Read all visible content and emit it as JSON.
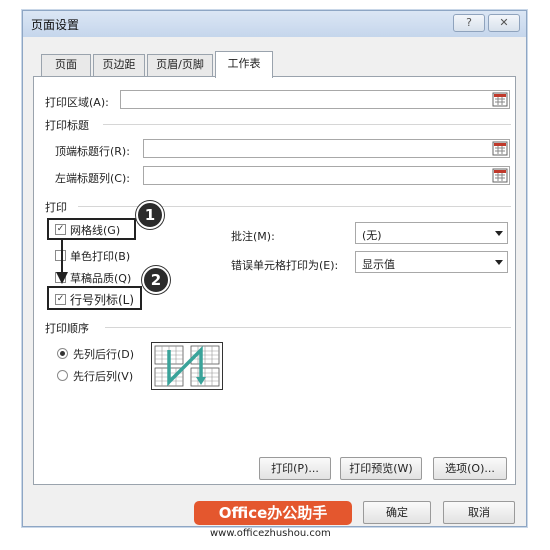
{
  "dialog": {
    "title": "页面设置",
    "help_label": "?",
    "close_label": "✕"
  },
  "tabs": [
    {
      "label": "页面",
      "active": false
    },
    {
      "label": "页边距",
      "active": false
    },
    {
      "label": "页眉/页脚",
      "active": false
    },
    {
      "label": "工作表",
      "active": true
    }
  ],
  "print_area": {
    "label": "打印区域(A):",
    "value": ""
  },
  "print_titles": {
    "heading": "打印标题",
    "top_rows": {
      "label": "顶端标题行(R):",
      "value": ""
    },
    "left_cols": {
      "label": "左端标题列(C):",
      "value": ""
    }
  },
  "print": {
    "heading": "打印",
    "gridlines": {
      "label": "网格线(G)",
      "checked": true
    },
    "black_white": {
      "label": "单色打印(B)",
      "checked": false
    },
    "draft": {
      "label": "草稿品质(Q)",
      "checked": false
    },
    "row_col_headings": {
      "label": "行号列标(L)",
      "checked": true
    },
    "comments": {
      "label": "批注(M):",
      "value": "(无)"
    },
    "cell_errors": {
      "label": "错误单元格打印为(E):",
      "value": "显示值"
    }
  },
  "page_order": {
    "heading": "打印顺序",
    "down_then_over": {
      "label": "先列后行(D)",
      "selected": true
    },
    "over_then_down": {
      "label": "先行后列(V)",
      "selected": false
    }
  },
  "buttons": {
    "print": "打印(P)...",
    "preview": "打印预览(W)",
    "options": "选项(O)...",
    "ok": "确定",
    "cancel": "取消"
  },
  "callouts": [
    "1",
    "2"
  ],
  "watermark": {
    "brand": "Office办公助手",
    "url": "www.officezhushou.com"
  },
  "colors": {
    "brand": "#e4572e",
    "accent_arrow": "#3aa39a"
  }
}
